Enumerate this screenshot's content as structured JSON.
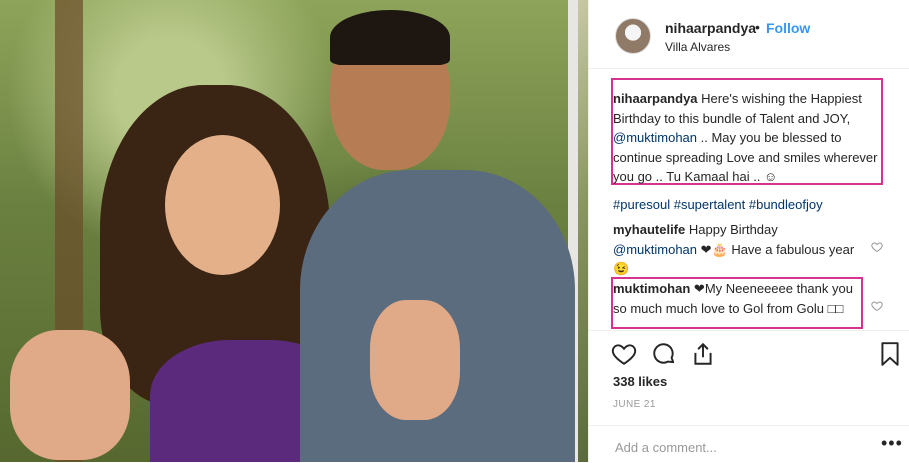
{
  "header": {
    "username": "nihaarpandya",
    "dot": "•",
    "follow_label": "Follow",
    "location": "Villa Alvares"
  },
  "caption": {
    "username": "nihaarpandya",
    "text_part1": "Here's wishing the Happiest Birthday to this bundle of Talent and JOY, ",
    "mention": "@muktimohan",
    "text_part2": " .. May you be blessed to continue spreading Love and smiles wherever you go .. Tu Kamaal hai .. ☺"
  },
  "hashtags": "#puresoul #supertalent #bundleofjoy",
  "comments": [
    {
      "username": "myhautelife",
      "text_part1": "Happy Birthday ",
      "mention": "@muktimohan",
      "text_part2": " ❤🎂 Have a fabulous year😉"
    },
    {
      "username": "muktimohan",
      "text": "❤My Neeneeeee thank you so much much love to Gol from Golu □□"
    }
  ],
  "likes": "338 likes",
  "date": "JUNE 21",
  "add_comment_placeholder": "Add a comment...",
  "more_label": "•••",
  "icons": {
    "like": "heart-icon",
    "comment": "comment-icon",
    "share": "share-icon",
    "save": "bookmark-icon"
  },
  "colors": {
    "accent_blue": "#3897f0",
    "link_blue": "#003569",
    "highlight_pink": "#d6338f"
  }
}
